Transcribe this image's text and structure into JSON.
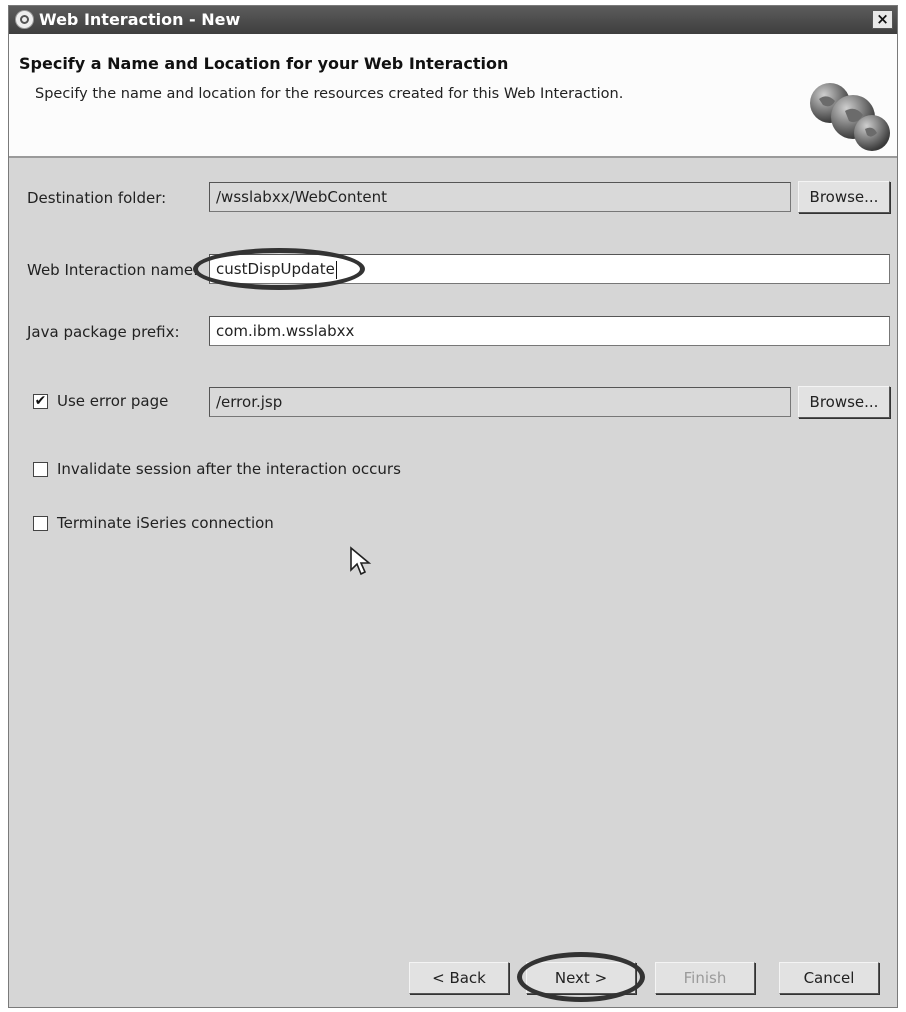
{
  "window": {
    "title": "Web Interaction - New",
    "close_glyph": "×"
  },
  "banner": {
    "title": "Specify a Name and Location for your Web Interaction",
    "description": "Specify the name and location for the resources created for this Web Interaction.",
    "icon": "globes-icon"
  },
  "form": {
    "destination_label": "Destination folder:",
    "destination_value": "/wsslabxx/WebContent",
    "browse_label": "Browse...",
    "name_label": "Web Interaction name:",
    "name_value": "custDispUpdate",
    "package_label": "Java package prefix:",
    "package_value": "com.ibm.wsslabxx",
    "error_page_label": "Use error page",
    "error_page_checked": true,
    "error_page_value": "/error.jsp",
    "invalidate_label": "Invalidate session after the interaction occurs",
    "invalidate_checked": false,
    "terminate_label": "Terminate iSeries connection",
    "terminate_checked": false
  },
  "buttons": {
    "back": "< Back",
    "next": "Next >",
    "finish": "Finish",
    "cancel": "Cancel"
  }
}
